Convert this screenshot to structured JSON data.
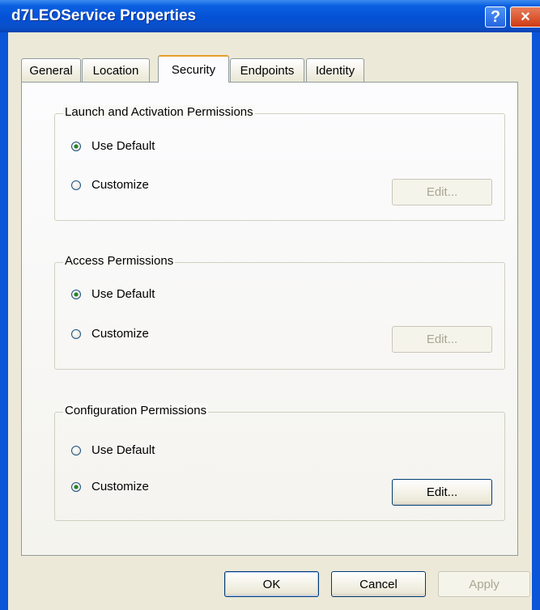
{
  "window": {
    "title": "d7LEOService Properties",
    "help_glyph": "?",
    "close_glyph": "×"
  },
  "tabs": [
    {
      "label": "General",
      "active": false
    },
    {
      "label": "Location",
      "active": false
    },
    {
      "label": "Security",
      "active": true
    },
    {
      "label": "Endpoints",
      "active": false
    },
    {
      "label": "Identity",
      "active": false
    }
  ],
  "groups": {
    "launch": {
      "title": "Launch and Activation Permissions",
      "use_default": "Use Default",
      "customize": "Customize",
      "edit": "Edit...",
      "selected": "use_default",
      "edit_enabled": false
    },
    "access": {
      "title": "Access Permissions",
      "use_default": "Use Default",
      "customize": "Customize",
      "edit": "Edit...",
      "selected": "use_default",
      "edit_enabled": false
    },
    "configuration": {
      "title": "Configuration Permissions",
      "use_default": "Use Default",
      "customize": "Customize",
      "edit": "Edit...",
      "selected": "customize",
      "edit_enabled": true
    }
  },
  "footer": {
    "ok": "OK",
    "cancel": "Cancel",
    "apply": "Apply",
    "apply_enabled": false
  },
  "colors": {
    "titlebar": "#0551d6",
    "active_tab_accent": "#e69f2a",
    "dialog_bg": "#ece9d8"
  }
}
